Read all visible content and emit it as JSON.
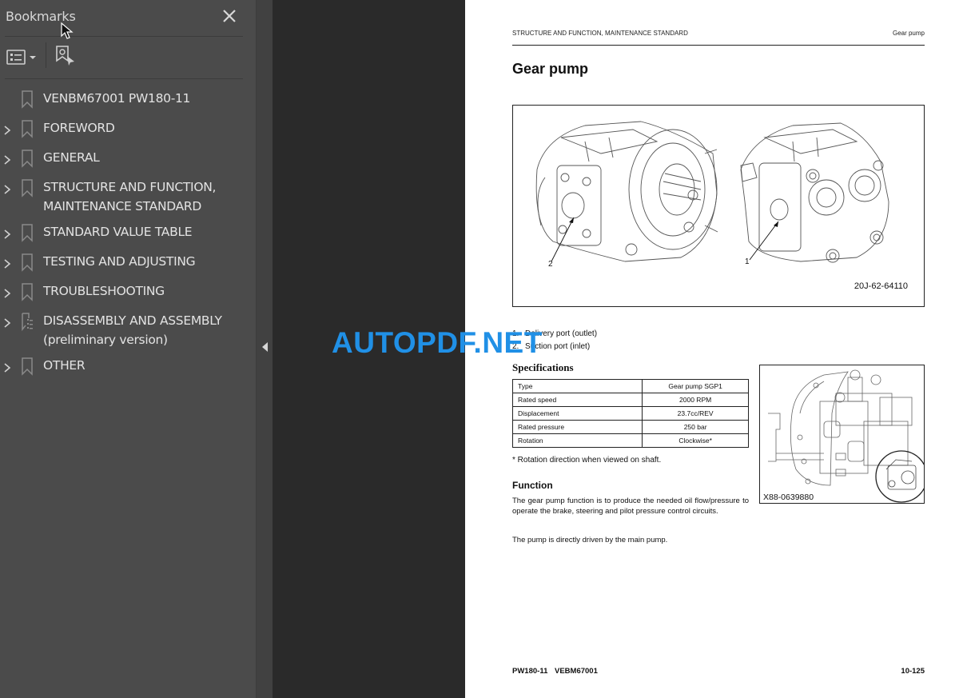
{
  "sidebar": {
    "title": "Bookmarks",
    "close_icon": "close-icon",
    "toolbar": {
      "options_icon": "list-options-icon",
      "find_icon": "find-current-bookmark-icon"
    },
    "items": [
      {
        "label": "VENBM67001 PW180-11",
        "expandable": false,
        "icon": "bookmark-icon"
      },
      {
        "label": "FOREWORD",
        "expandable": true,
        "icon": "bookmark-icon"
      },
      {
        "label": "GENERAL",
        "expandable": true,
        "icon": "bookmark-icon"
      },
      {
        "label": "STRUCTURE AND FUNCTION, MAINTENANCE STANDARD",
        "expandable": true,
        "icon": "bookmark-icon"
      },
      {
        "label": "STANDARD VALUE TABLE",
        "expandable": true,
        "icon": "bookmark-icon"
      },
      {
        "label": "TESTING AND ADJUSTING",
        "expandable": true,
        "icon": "bookmark-icon"
      },
      {
        "label": "TROUBLESHOOTING",
        "expandable": true,
        "icon": "bookmark-icon"
      },
      {
        "label": "DISASSEMBLY AND ASSEMBLY (preliminary version)",
        "expandable": true,
        "icon": "bookmark-structure-icon"
      },
      {
        "label": "OTHER",
        "expandable": true,
        "icon": "bookmark-icon"
      }
    ]
  },
  "collapse_icon": "collapse-panel-arrow-icon",
  "watermark": "AUTOPDF.NET",
  "page": {
    "header_left": "STRUCTURE AND FUNCTION, MAINTENANCE STANDARD",
    "header_right": "Gear pump",
    "title": "Gear pump",
    "figure1": {
      "code": "20J-62-64110",
      "callouts": [
        "2",
        "1"
      ]
    },
    "legend": [
      {
        "num": "1.",
        "text": "Delivery port (outlet)"
      },
      {
        "num": "2.",
        "text": "Suction port (inlet)"
      }
    ],
    "specifications": {
      "title": "Specifications",
      "rows": [
        {
          "label": "Type",
          "value": "Gear pump SGP1"
        },
        {
          "label": "Rated speed",
          "value": "2000 RPM"
        },
        {
          "label": "Displacement",
          "value": "23.7cc/REV"
        },
        {
          "label": "Rated pressure",
          "value": "250 bar"
        },
        {
          "label": "Rotation",
          "value": "Clockwise*"
        }
      ],
      "note": "* Rotation direction when viewed on shaft."
    },
    "figure2": {
      "code": "X88-0639880"
    },
    "function": {
      "title": "Function",
      "paragraph1": "The gear pump function is to produce the needed oil flow/pressure to operate the brake, steering and pilot pressure control circuits.",
      "paragraph2": "The pump is directly driven by the main pump."
    },
    "footer_left": "PW180-11 VEBM67001",
    "footer_right": "10-125"
  }
}
